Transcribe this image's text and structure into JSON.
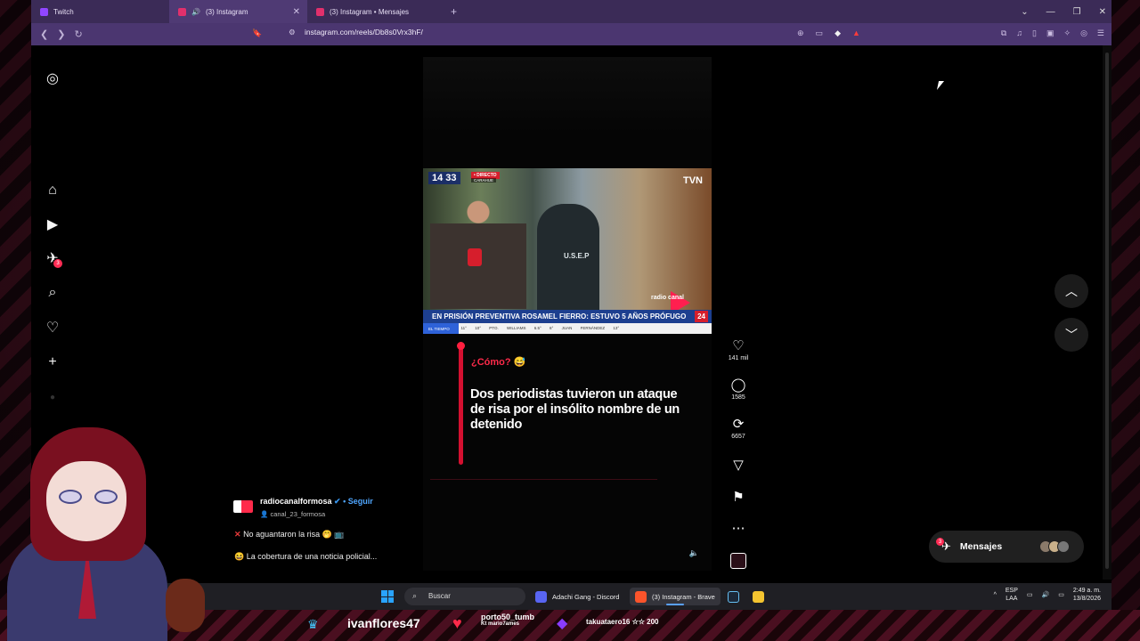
{
  "browser": {
    "tabs": [
      {
        "label": "Twitch",
        "fav_color": "#9146ff",
        "active": false
      },
      {
        "label": "(3) Instagram",
        "fav_color": "#e1306c",
        "active": true
      },
      {
        "label": "(3) Instagram • Mensajes",
        "fav_color": "#e1306c",
        "active": false
      }
    ],
    "tab_close": "✕",
    "new_tab": "+",
    "url": "instagram.com/reels/Db8s0Vrx3hF/"
  },
  "instagram": {
    "sidebar_badge": "3",
    "news": {
      "clock": "14 33",
      "live": "• DIRECTO",
      "city": "CARAHUE",
      "channel": "TVN",
      "vest": "U.S.E.P",
      "ticker": "EN PRISIÓN PREVENTIVA ROSAMEL FIERRO: ESTUVO 5 AÑOS PRÓFUGO",
      "ticker_tag": "24",
      "weather_label": "EL TIEMPO",
      "weather": "SANTIAGO 11° 10° PTO. WILLIAMS 6.5° 6° JUAN FERNÁNDEZ 13°",
      "brand": "radio canal"
    },
    "caption_small": "¿Cómo? 😅",
    "caption_big": "Dos periodistas tuvieron un ataque de risa por el insólito nombre de un detenido",
    "actions": {
      "likes": "141 mil",
      "comments": "1585",
      "reposts": "6657"
    },
    "author": {
      "name": "radiocanalformosa",
      "follow": "Seguir",
      "sub": "canal_23_formosa"
    },
    "desc_line1": "No aguantaron la risa 🤭 📺",
    "desc_line2": "😆 La cobertura de una noticia policial...",
    "messages": {
      "label": "Mensajes",
      "count": "3"
    }
  },
  "taskbar": {
    "search": "Buscar",
    "apps": [
      {
        "label": "Adachi Gang - Discord"
      },
      {
        "label": "(3) Instagram - Brave"
      }
    ],
    "lang_top": "ESP",
    "lang_bottom": "LAA",
    "time": "2:49 a. m.",
    "date": "13/8/2026"
  },
  "overlay": {
    "viewer_name": "ivanflores47",
    "sub_line1": "porto50_tumb",
    "sub_line2": "Kt mario7ames",
    "gift": "takuataero16 ☆☆ 200"
  },
  "colors": {
    "accent_pink": "#ff2a4a",
    "browser_purple": "#4b3670",
    "link_blue": "#4fa6ff"
  }
}
